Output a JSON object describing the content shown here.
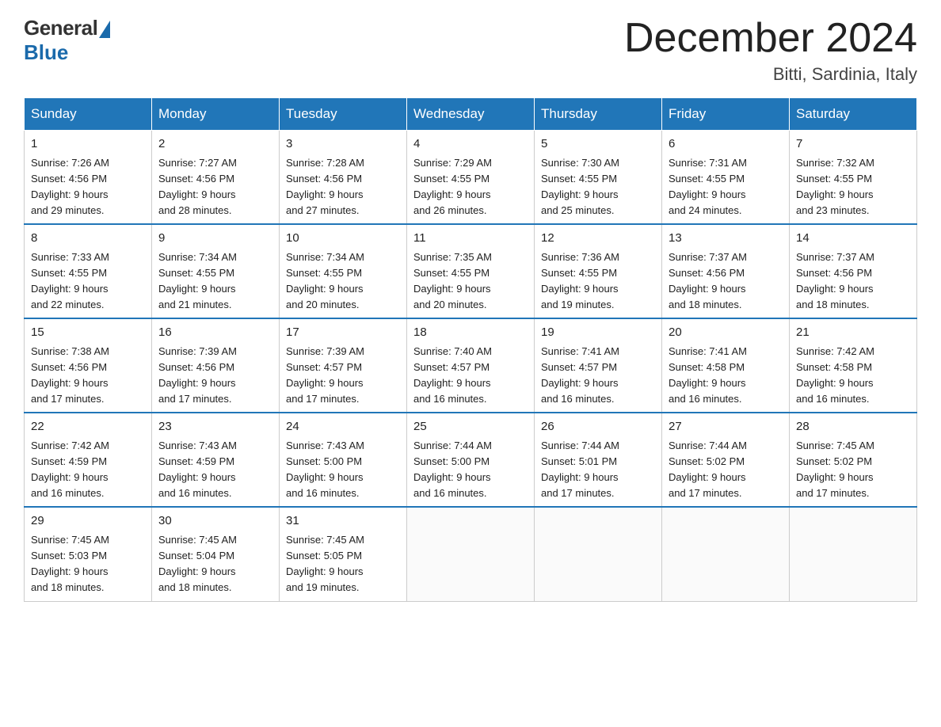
{
  "logo": {
    "general_text": "General",
    "blue_text": "Blue"
  },
  "header": {
    "month_year": "December 2024",
    "location": "Bitti, Sardinia, Italy"
  },
  "days_of_week": [
    "Sunday",
    "Monday",
    "Tuesday",
    "Wednesday",
    "Thursday",
    "Friday",
    "Saturday"
  ],
  "weeks": [
    [
      {
        "day": "1",
        "sunrise": "7:26 AM",
        "sunset": "4:56 PM",
        "daylight": "9 hours and 29 minutes."
      },
      {
        "day": "2",
        "sunrise": "7:27 AM",
        "sunset": "4:56 PM",
        "daylight": "9 hours and 28 minutes."
      },
      {
        "day": "3",
        "sunrise": "7:28 AM",
        "sunset": "4:56 PM",
        "daylight": "9 hours and 27 minutes."
      },
      {
        "day": "4",
        "sunrise": "7:29 AM",
        "sunset": "4:55 PM",
        "daylight": "9 hours and 26 minutes."
      },
      {
        "day": "5",
        "sunrise": "7:30 AM",
        "sunset": "4:55 PM",
        "daylight": "9 hours and 25 minutes."
      },
      {
        "day": "6",
        "sunrise": "7:31 AM",
        "sunset": "4:55 PM",
        "daylight": "9 hours and 24 minutes."
      },
      {
        "day": "7",
        "sunrise": "7:32 AM",
        "sunset": "4:55 PM",
        "daylight": "9 hours and 23 minutes."
      }
    ],
    [
      {
        "day": "8",
        "sunrise": "7:33 AM",
        "sunset": "4:55 PM",
        "daylight": "9 hours and 22 minutes."
      },
      {
        "day": "9",
        "sunrise": "7:34 AM",
        "sunset": "4:55 PM",
        "daylight": "9 hours and 21 minutes."
      },
      {
        "day": "10",
        "sunrise": "7:34 AM",
        "sunset": "4:55 PM",
        "daylight": "9 hours and 20 minutes."
      },
      {
        "day": "11",
        "sunrise": "7:35 AM",
        "sunset": "4:55 PM",
        "daylight": "9 hours and 20 minutes."
      },
      {
        "day": "12",
        "sunrise": "7:36 AM",
        "sunset": "4:55 PM",
        "daylight": "9 hours and 19 minutes."
      },
      {
        "day": "13",
        "sunrise": "7:37 AM",
        "sunset": "4:56 PM",
        "daylight": "9 hours and 18 minutes."
      },
      {
        "day": "14",
        "sunrise": "7:37 AM",
        "sunset": "4:56 PM",
        "daylight": "9 hours and 18 minutes."
      }
    ],
    [
      {
        "day": "15",
        "sunrise": "7:38 AM",
        "sunset": "4:56 PM",
        "daylight": "9 hours and 17 minutes."
      },
      {
        "day": "16",
        "sunrise": "7:39 AM",
        "sunset": "4:56 PM",
        "daylight": "9 hours and 17 minutes."
      },
      {
        "day": "17",
        "sunrise": "7:39 AM",
        "sunset": "4:57 PM",
        "daylight": "9 hours and 17 minutes."
      },
      {
        "day": "18",
        "sunrise": "7:40 AM",
        "sunset": "4:57 PM",
        "daylight": "9 hours and 16 minutes."
      },
      {
        "day": "19",
        "sunrise": "7:41 AM",
        "sunset": "4:57 PM",
        "daylight": "9 hours and 16 minutes."
      },
      {
        "day": "20",
        "sunrise": "7:41 AM",
        "sunset": "4:58 PM",
        "daylight": "9 hours and 16 minutes."
      },
      {
        "day": "21",
        "sunrise": "7:42 AM",
        "sunset": "4:58 PM",
        "daylight": "9 hours and 16 minutes."
      }
    ],
    [
      {
        "day": "22",
        "sunrise": "7:42 AM",
        "sunset": "4:59 PM",
        "daylight": "9 hours and 16 minutes."
      },
      {
        "day": "23",
        "sunrise": "7:43 AM",
        "sunset": "4:59 PM",
        "daylight": "9 hours and 16 minutes."
      },
      {
        "day": "24",
        "sunrise": "7:43 AM",
        "sunset": "5:00 PM",
        "daylight": "9 hours and 16 minutes."
      },
      {
        "day": "25",
        "sunrise": "7:44 AM",
        "sunset": "5:00 PM",
        "daylight": "9 hours and 16 minutes."
      },
      {
        "day": "26",
        "sunrise": "7:44 AM",
        "sunset": "5:01 PM",
        "daylight": "9 hours and 17 minutes."
      },
      {
        "day": "27",
        "sunrise": "7:44 AM",
        "sunset": "5:02 PM",
        "daylight": "9 hours and 17 minutes."
      },
      {
        "day": "28",
        "sunrise": "7:45 AM",
        "sunset": "5:02 PM",
        "daylight": "9 hours and 17 minutes."
      }
    ],
    [
      {
        "day": "29",
        "sunrise": "7:45 AM",
        "sunset": "5:03 PM",
        "daylight": "9 hours and 18 minutes."
      },
      {
        "day": "30",
        "sunrise": "7:45 AM",
        "sunset": "5:04 PM",
        "daylight": "9 hours and 18 minutes."
      },
      {
        "day": "31",
        "sunrise": "7:45 AM",
        "sunset": "5:05 PM",
        "daylight": "9 hours and 19 minutes."
      },
      null,
      null,
      null,
      null
    ]
  ],
  "labels": {
    "sunrise": "Sunrise:",
    "sunset": "Sunset:",
    "daylight": "Daylight:"
  }
}
